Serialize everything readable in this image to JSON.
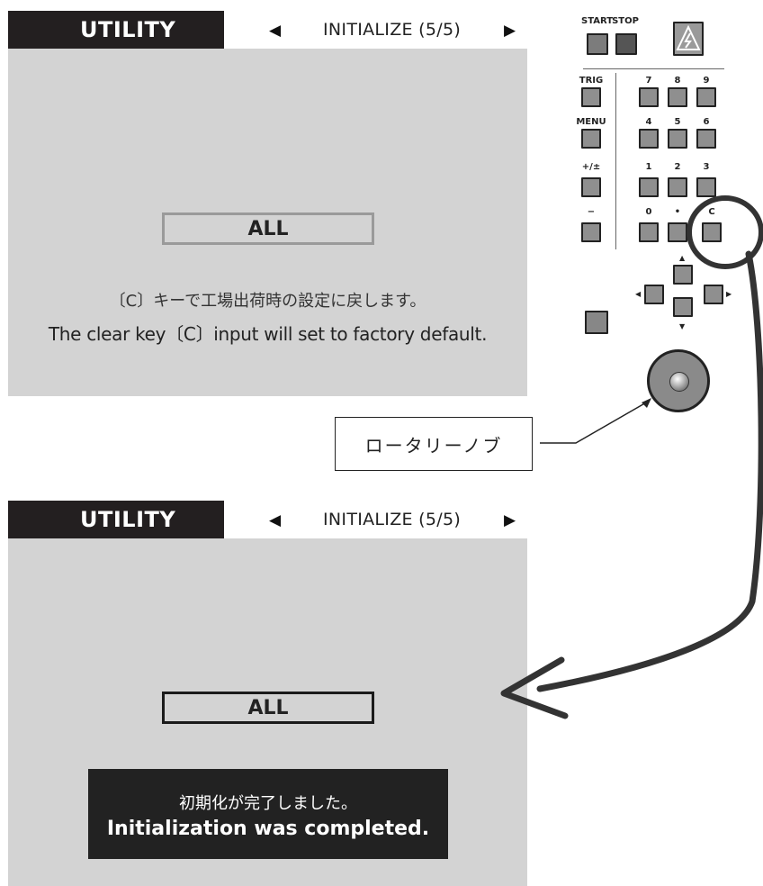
{
  "screens": [
    {
      "header_title": "UTILITY",
      "page_label": "INITIALIZE (5/5)",
      "prev_icon": "◀",
      "next_icon": "▶",
      "selected_item": "ALL",
      "message_ja": "〔C〕キーで工場出荷時の設定に戻します。",
      "message_en": "The clear key〔C〕input will set to factory default."
    },
    {
      "header_title": "UTILITY",
      "page_label": "INITIALIZE (5/5)",
      "prev_icon": "◀",
      "next_icon": "▶",
      "selected_item": "ALL",
      "complete_ja": "初期化が完了しました。",
      "complete_en": "Initialization was completed."
    }
  ],
  "keypad": {
    "start_label": "START",
    "stop_label": "STOP",
    "trig_label": "TRIG",
    "menu_label": "MENU",
    "plusminus_label": "+/±",
    "minus_label": "−",
    "digits": [
      "7",
      "8",
      "9",
      "4",
      "5",
      "6",
      "1",
      "2",
      "3",
      "0",
      "•"
    ],
    "clear_label": "C"
  },
  "callout_label": "ロータリーノブ",
  "colors": {
    "screen_bg": "#d3d3d3",
    "header_dark": "#231f20",
    "key_fill": "#8f8f8f"
  }
}
